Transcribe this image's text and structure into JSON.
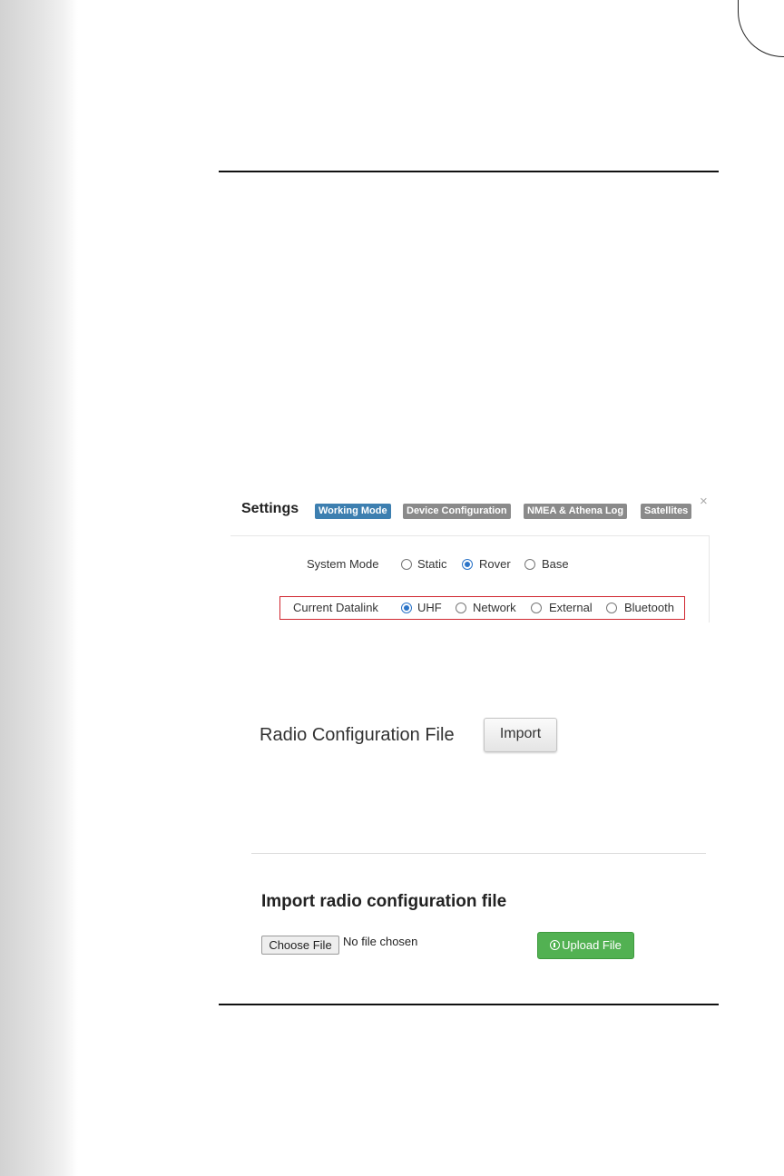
{
  "settings": {
    "title": "Settings",
    "tabs": [
      {
        "label": "Working Mode",
        "active": true
      },
      {
        "label": "Device Configuration",
        "active": false
      },
      {
        "label": "NMEA & Athena Log",
        "active": false
      },
      {
        "label": "Satellites",
        "active": false
      }
    ],
    "close_glyph": "×",
    "system_mode": {
      "label": "System Mode",
      "options": [
        "Static",
        "Rover",
        "Base"
      ],
      "selected": "Rover"
    },
    "current_datalink": {
      "label": "Current Datalink",
      "options": [
        "UHF",
        "Network",
        "External",
        "Bluetooth"
      ],
      "selected": "UHF"
    }
  },
  "radio_config": {
    "label": "Radio Configuration File",
    "import_label": "Import"
  },
  "import_dialog": {
    "heading": "Import radio configuration file",
    "choose_label": "Choose File",
    "file_status": "No file chosen",
    "upload_label": "Upload File"
  },
  "colors": {
    "active_tab": "#3d7fb0",
    "inactive_tab": "#8a8a8a",
    "highlight": "#d0262f",
    "upload_button": "#52b152"
  }
}
